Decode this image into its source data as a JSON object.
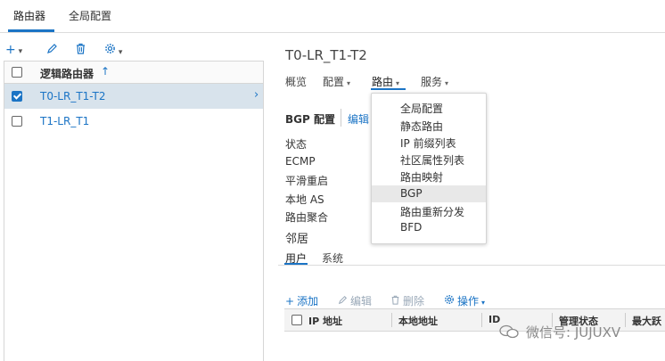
{
  "top_tabs": [
    {
      "label": "路由器",
      "active": true
    },
    {
      "label": "全局配置",
      "active": false
    }
  ],
  "left_toolbar": {
    "add_icon": "plus-icon",
    "edit_icon": "pencil-icon",
    "delete_icon": "trash-icon",
    "settings_icon": "gear-icon"
  },
  "router_list": {
    "header": "逻辑路由器",
    "sort_indicator": "↑",
    "rows": [
      {
        "name": "T0-LR_T1-T2",
        "checked": true,
        "selected": true
      },
      {
        "name": "T1-LR_T1",
        "checked": false,
        "selected": false
      }
    ]
  },
  "detail": {
    "title": "T0-LR_T1-T2",
    "nav": [
      {
        "label": "概览"
      },
      {
        "label": "配置"
      },
      {
        "label": "路由"
      },
      {
        "label": "服务"
      }
    ],
    "bgp": {
      "title": "BGP 配置",
      "edit": "编辑",
      "fields": [
        "状态",
        "ECMP",
        "平滑重启",
        "本地 AS",
        "路由聚合"
      ]
    },
    "neighbors": {
      "title": "邻居",
      "tabs": [
        "用户",
        "系统"
      ],
      "actions": [
        "添加",
        "编辑",
        "删除",
        "操作"
      ],
      "columns": [
        "IP 地址",
        "本地地址",
        "ID",
        "管理状态",
        "最大跃"
      ]
    }
  },
  "routing_menu": {
    "items": [
      "全局配置",
      "静态路由",
      "IP 前缀列表",
      "社区属性列表",
      "路由映射",
      "BGP",
      "路由重新分发",
      "BFD"
    ],
    "highlighted": "BGP"
  },
  "watermark": "微信号: JUJUXV",
  "colors": {
    "accent": "#1b74c5",
    "selected_row": "#d8e3ec",
    "menu_highlight": "#e8e8e8"
  }
}
